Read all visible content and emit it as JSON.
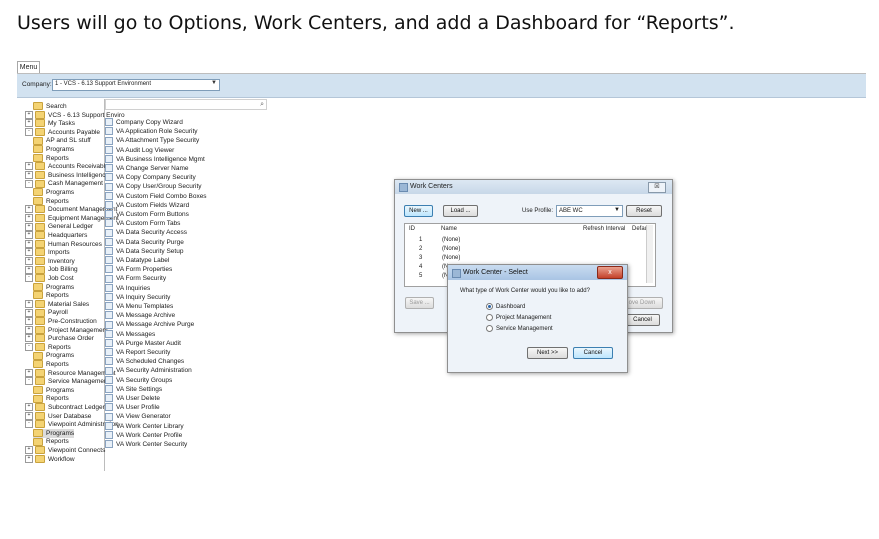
{
  "instruction": "Users will go to Options, Work Centers, and add a Dashboard for “Reports”.",
  "menu_tab": "Menu",
  "company": {
    "label": "Company:",
    "value": "1 - VCS - 6.13 Support Environment"
  },
  "nav_tree": [
    {
      "label": "Search",
      "indent": 1,
      "exp": ""
    },
    {
      "label": "VCS - 6.13 Support Enviro",
      "indent": 0,
      "exp": "+"
    },
    {
      "label": "My Tasks",
      "indent": 0,
      "exp": "+"
    },
    {
      "label": "Accounts Payable",
      "indent": 0,
      "exp": "-"
    },
    {
      "label": "AP and SL stuff",
      "indent": 1,
      "exp": ""
    },
    {
      "label": "Programs",
      "indent": 1,
      "exp": ""
    },
    {
      "label": "Reports",
      "indent": 1,
      "exp": ""
    },
    {
      "label": "Accounts Receivable",
      "indent": 0,
      "exp": "+"
    },
    {
      "label": "Business Intelligence",
      "indent": 0,
      "exp": "+"
    },
    {
      "label": "Cash Management",
      "indent": 0,
      "exp": "-"
    },
    {
      "label": "Programs",
      "indent": 1,
      "exp": ""
    },
    {
      "label": "Reports",
      "indent": 1,
      "exp": ""
    },
    {
      "label": "Document Management",
      "indent": 0,
      "exp": "+"
    },
    {
      "label": "Equipment Management",
      "indent": 0,
      "exp": "+"
    },
    {
      "label": "General Ledger",
      "indent": 0,
      "exp": "+"
    },
    {
      "label": "Headquarters",
      "indent": 0,
      "exp": "+"
    },
    {
      "label": "Human Resources",
      "indent": 0,
      "exp": "+"
    },
    {
      "label": "Imports",
      "indent": 0,
      "exp": "+"
    },
    {
      "label": "Inventory",
      "indent": 0,
      "exp": "+"
    },
    {
      "label": "Job Billing",
      "indent": 0,
      "exp": "+"
    },
    {
      "label": "Job Cost",
      "indent": 0,
      "exp": "-"
    },
    {
      "label": "Programs",
      "indent": 1,
      "exp": ""
    },
    {
      "label": "Reports",
      "indent": 1,
      "exp": ""
    },
    {
      "label": "Material Sales",
      "indent": 0,
      "exp": "+"
    },
    {
      "label": "Payroll",
      "indent": 0,
      "exp": "+"
    },
    {
      "label": "Pre-Construction",
      "indent": 0,
      "exp": "+"
    },
    {
      "label": "Project Management",
      "indent": 0,
      "exp": "+"
    },
    {
      "label": "Purchase Order",
      "indent": 0,
      "exp": "+"
    },
    {
      "label": "Reports",
      "indent": 0,
      "exp": "-"
    },
    {
      "label": "Programs",
      "indent": 1,
      "exp": ""
    },
    {
      "label": "Reports",
      "indent": 1,
      "exp": ""
    },
    {
      "label": "Resource Management",
      "indent": 0,
      "exp": "+"
    },
    {
      "label": "Service Management",
      "indent": 0,
      "exp": "-"
    },
    {
      "label": "Programs",
      "indent": 1,
      "exp": ""
    },
    {
      "label": "Reports",
      "indent": 1,
      "exp": ""
    },
    {
      "label": "Subcontract Ledger",
      "indent": 0,
      "exp": "+"
    },
    {
      "label": "User Database",
      "indent": 0,
      "exp": "+"
    },
    {
      "label": "Viewpoint Administration",
      "indent": 0,
      "exp": "-"
    },
    {
      "label": "Programs",
      "indent": 1,
      "exp": "",
      "selected": true
    },
    {
      "label": "Reports",
      "indent": 1,
      "exp": ""
    },
    {
      "label": "Viewpoint Connects",
      "indent": 0,
      "exp": "+"
    },
    {
      "label": "Workflow",
      "indent": 0,
      "exp": "+"
    }
  ],
  "programs": [
    "Company Copy Wizard",
    "VA Application Role Security",
    "VA Attachment Type Security",
    "VA Audit Log Viewer",
    "VA Business Intelligence Mgmt",
    "VA Change Server Name",
    "VA Copy Company Security",
    "VA Copy User/Group Security",
    "VA Custom Field Combo Boxes",
    "VA Custom Fields Wizard",
    "VA Custom Form Buttons",
    "VA Custom Form Tabs",
    "VA Data Security Access",
    "VA Data Security Purge",
    "VA Data Security Setup",
    "VA Datatype Label",
    "VA Form Properties",
    "VA Form Security",
    "VA Inquiries",
    "VA Inquiry Security",
    "VA Menu Templates",
    "VA Message Archive",
    "VA Message Archive Purge",
    "VA Messages",
    "VA Purge Master Audit",
    "VA Report Security",
    "VA Scheduled Changes",
    "VA Security Administration",
    "VA Security Groups",
    "VA Site Settings",
    "VA User Delete",
    "VA User Profile",
    "VA View Generator",
    "VA Work Center Library",
    "VA Work Center Profile",
    "VA Work Center Security"
  ],
  "work_centers": {
    "title": "Work Centers",
    "close": "☒",
    "new_label": "New ...",
    "load_label": "Load ...",
    "use_profile_label": "Use Profile:",
    "use_profile_value": "ABE WC",
    "reset_label": "Reset",
    "columns": [
      "ID",
      "Name",
      "Refresh Interval",
      "Default"
    ],
    "rows": [
      {
        "id": "1",
        "name": "(None)"
      },
      {
        "id": "2",
        "name": "(None)"
      },
      {
        "id": "3",
        "name": "(None)"
      },
      {
        "id": "4",
        "name": "(N"
      },
      {
        "id": "5",
        "name": "(N"
      }
    ],
    "save_label": "Save ...",
    "move_down_label": "ove Down",
    "cancel_label": "Cancel"
  },
  "select_dialog": {
    "title": "Work Center - Select",
    "close": "x",
    "question": "What type of Work Center would you like to add?",
    "options": [
      {
        "label": "Dashboard",
        "selected": true
      },
      {
        "label": "Project Management",
        "selected": false
      },
      {
        "label": "Service Management",
        "selected": false
      }
    ],
    "next_label": "Next >>",
    "cancel_label": "Cancel"
  }
}
